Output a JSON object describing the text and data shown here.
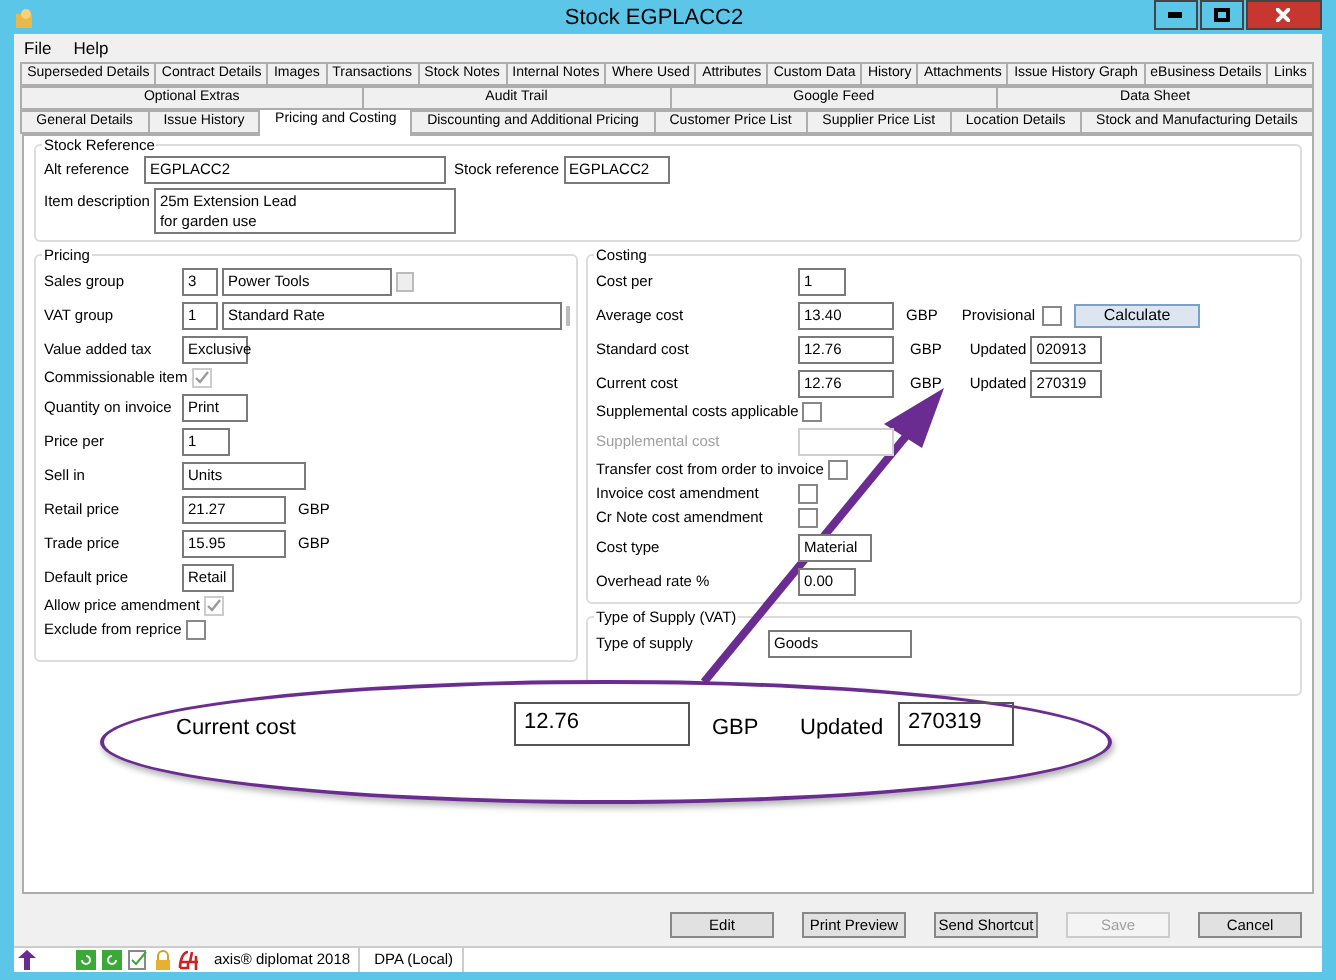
{
  "window": {
    "title": "Stock EGPLACC2"
  },
  "menu": [
    "File",
    "Help"
  ],
  "tab_rows": [
    [
      {
        "label": "Superseded Details",
        "selected": false
      },
      {
        "label": "Contract Details",
        "selected": false
      },
      {
        "label": "Images",
        "selected": false
      },
      {
        "label": "Transactions",
        "selected": false
      },
      {
        "label": "Stock Notes",
        "selected": false
      },
      {
        "label": "Internal Notes",
        "selected": false
      },
      {
        "label": "Where Used",
        "selected": false
      },
      {
        "label": "Attributes",
        "selected": false
      },
      {
        "label": "Custom Data",
        "selected": false
      },
      {
        "label": "History",
        "selected": false
      },
      {
        "label": "Attachments",
        "selected": false
      },
      {
        "label": "Issue History Graph",
        "selected": false
      },
      {
        "label": "eBusiness Details",
        "selected": false
      },
      {
        "label": "Links",
        "selected": false
      }
    ],
    [
      {
        "label": "Optional Extras",
        "selected": false
      },
      {
        "label": "Audit Trail",
        "selected": false
      },
      {
        "label": "Google Feed",
        "selected": false
      },
      {
        "label": "Data Sheet",
        "selected": false
      }
    ],
    [
      {
        "label": "General Details",
        "selected": false
      },
      {
        "label": "Issue History",
        "selected": false
      },
      {
        "label": "Pricing and Costing",
        "selected": true
      },
      {
        "label": "Discounting and Additional Pricing",
        "selected": false
      },
      {
        "label": "Customer Price List",
        "selected": false
      },
      {
        "label": "Supplier Price List",
        "selected": false
      },
      {
        "label": "Location Details",
        "selected": false
      },
      {
        "label": "Stock and Manufacturing Details",
        "selected": false
      }
    ]
  ],
  "stock_reference": {
    "title": "Stock Reference",
    "alt_reference": {
      "label": "Alt reference",
      "value": "EGPLACC2"
    },
    "stock_reference": {
      "label": "Stock reference",
      "value": "EGPLACC2"
    },
    "item_description": {
      "label": "Item description",
      "value": "25m Extension Lead\nfor garden use"
    }
  },
  "pricing": {
    "title": "Pricing",
    "rows": [
      {
        "kind": "pair",
        "label": "Sales group",
        "code": "3",
        "value": "Power Tools"
      },
      {
        "kind": "pair",
        "label": "VAT group",
        "code": "1",
        "value": "Standard Rate"
      },
      {
        "kind": "field",
        "label": "Value added tax",
        "value": "Exclusive"
      },
      {
        "kind": "check",
        "label": "Commissionable item",
        "checked": true,
        "disabled": true
      },
      {
        "kind": "field",
        "label": "Quantity on invoice",
        "value": "Print"
      },
      {
        "kind": "field",
        "label": "Price per",
        "value": "1"
      },
      {
        "kind": "field",
        "label": "Sell in",
        "value": "Units"
      },
      {
        "kind": "money",
        "label": "Retail price",
        "value": "21.27",
        "unit": "GBP"
      },
      {
        "kind": "money",
        "label": "Trade price",
        "value": "15.95",
        "unit": "GBP"
      },
      {
        "kind": "field",
        "label": "Default price",
        "value": "Retail"
      },
      {
        "kind": "check",
        "label": "Allow price amendment",
        "checked": true,
        "disabled": true
      },
      {
        "kind": "check",
        "label": "Exclude from reprice",
        "checked": false,
        "disabled": false
      }
    ]
  },
  "costing": {
    "title": "Costing",
    "rows": [
      {
        "kind": "field",
        "label": "Cost per",
        "value": "1",
        "disabled": false
      },
      {
        "kind": "money",
        "label": "Average cost",
        "value": "13.40",
        "unit": "GBP",
        "provisional": {
          "label": "Provisional",
          "checked": false
        },
        "button": "Calculate"
      },
      {
        "kind": "money",
        "label": "Standard cost",
        "value": "12.76",
        "unit": "GBP",
        "updated": {
          "label": "Updated",
          "value": "020913"
        }
      },
      {
        "kind": "money",
        "label": "Current cost",
        "value": "12.76",
        "unit": "GBP",
        "updated": {
          "label": "Updated",
          "value": "270319"
        }
      },
      {
        "kind": "check",
        "label": "Supplemental costs applicable",
        "checked": false,
        "disabled": false
      },
      {
        "kind": "field",
        "label": "Supplemental cost",
        "value": "",
        "disabled": true
      },
      {
        "kind": "check",
        "label": "Transfer cost from order to invoice",
        "checked": false,
        "disabled": false
      },
      {
        "kind": "check",
        "label": "Invoice cost amendment",
        "checked": false,
        "disabled": false
      },
      {
        "kind": "check",
        "label": "Cr Note cost amendment",
        "checked": false,
        "disabled": false
      },
      {
        "kind": "field",
        "label": "Cost type",
        "value": "Material",
        "disabled": false
      },
      {
        "kind": "field",
        "label": "Overhead rate %",
        "value": "0.00",
        "disabled": false
      }
    ]
  },
  "type_of_supply": {
    "title": "Type of Supply (VAT)",
    "label": "Type of supply",
    "value": "Goods"
  },
  "callout": {
    "label": "Current cost",
    "value": "12.76",
    "unit": "GBP",
    "updated_label": "Updated",
    "updated_value": "270319"
  },
  "buttons": [
    {
      "label": "Edit",
      "disabled": false
    },
    {
      "label": "Print Preview",
      "disabled": false
    },
    {
      "label": "Send Shortcut",
      "disabled": false
    },
    {
      "label": "Save",
      "disabled": true
    },
    {
      "label": "Cancel",
      "disabled": false
    }
  ],
  "status_bar": {
    "product": "axis® diplomat 2018",
    "database": "DPA (Local)"
  }
}
